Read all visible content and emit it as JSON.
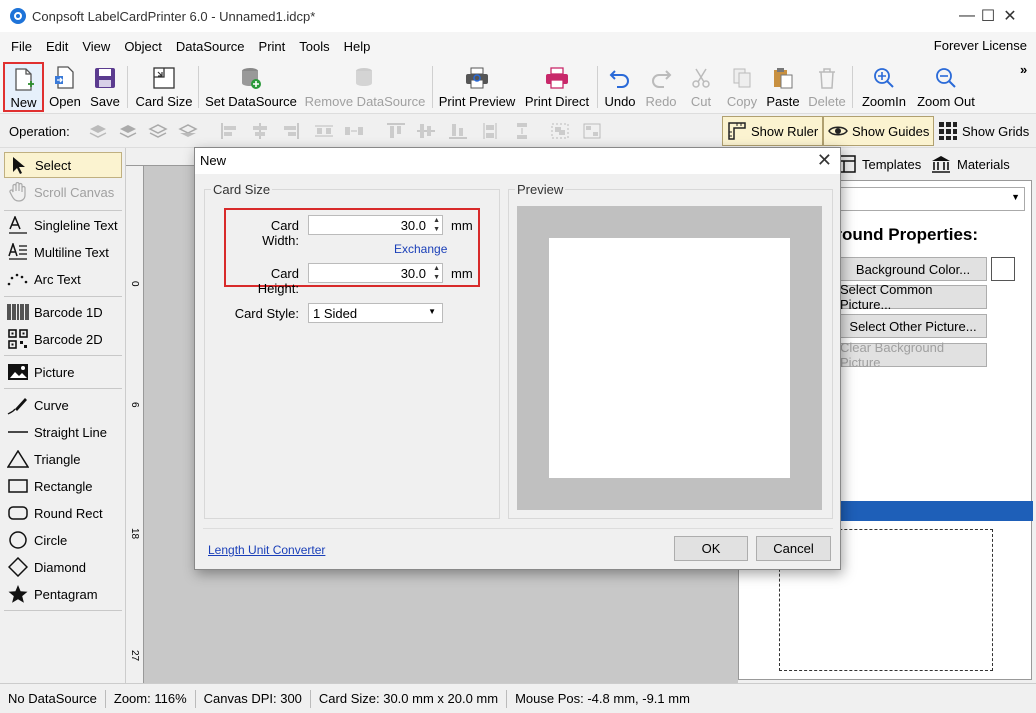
{
  "window": {
    "title": "Conpsoft LabelCardPrinter 6.0 - Unnamed1.idcp*",
    "minimize": "—",
    "maximize": "☐",
    "close": "✕"
  },
  "menu": {
    "items": [
      "File",
      "Edit",
      "View",
      "Object",
      "DataSource",
      "Print",
      "Tools",
      "Help"
    ],
    "license": "Forever License"
  },
  "toolbar": {
    "new": "New",
    "open": "Open",
    "save": "Save",
    "card_size": "Card Size",
    "set_datasource": "Set DataSource",
    "remove_datasource": "Remove DataSource",
    "print_preview": "Print Preview",
    "print_direct": "Print Direct",
    "undo": "Undo",
    "redo": "Redo",
    "cut": "Cut",
    "copy": "Copy",
    "paste": "Paste",
    "delete": "Delete",
    "zoom_in": "ZoomIn",
    "zoom_out": "Zoom Out",
    "overflow": "»"
  },
  "operation": {
    "label": "Operation:",
    "show_ruler": "Show Ruler",
    "show_guides": "Show Guides",
    "show_grids": "Show Grids"
  },
  "tools": {
    "select": "Select",
    "scroll_canvas": "Scroll Canvas",
    "singleline_text": "Singleline Text",
    "multiline_text": "Multiline Text",
    "arc_text": "Arc Text",
    "barcode_1d": "Barcode 1D",
    "barcode_2d": "Barcode 2D",
    "picture": "Picture",
    "curve": "Curve",
    "straight_line": "Straight Line",
    "triangle": "Triangle",
    "rectangle": "Rectangle",
    "round_rect": "Round Rect",
    "circle": "Circle",
    "diamond": "Diamond",
    "pentagram": "Pentagram"
  },
  "ruler": {
    "marks": [
      "0",
      "6",
      "18",
      "27"
    ]
  },
  "right_panel": {
    "tab_templates": "Templates",
    "tab_materials": "Materials",
    "bg_title": "ground Properties:",
    "background_color": "Background Color...",
    "select_common_picture": "Select Common Picture...",
    "select_other_picture": "Select Other Picture...",
    "clear_background_picture": "Clear Background Picture"
  },
  "status": {
    "datasource": "No DataSource",
    "zoom": "Zoom: 116%",
    "dpi": "Canvas DPI: 300",
    "card_size": "Card Size: 30.0 mm x 20.0 mm",
    "mouse_pos": "Mouse Pos: -4.8 mm, -9.1 mm"
  },
  "dialog": {
    "title": "New",
    "close": "✕",
    "card_size_group": "Card Size",
    "card_width_label": "Card Width:",
    "card_width_value": "30.0",
    "card_width_unit": "mm",
    "exchange": "Exchange",
    "card_height_label": "Card Height:",
    "card_height_value": "30.0",
    "card_height_unit": "mm",
    "card_style_label": "Card Style:",
    "card_style_value": "1 Sided",
    "preview_group": "Preview",
    "length_unit_converter": "Length Unit Converter",
    "ok": "OK",
    "cancel": "Cancel"
  }
}
